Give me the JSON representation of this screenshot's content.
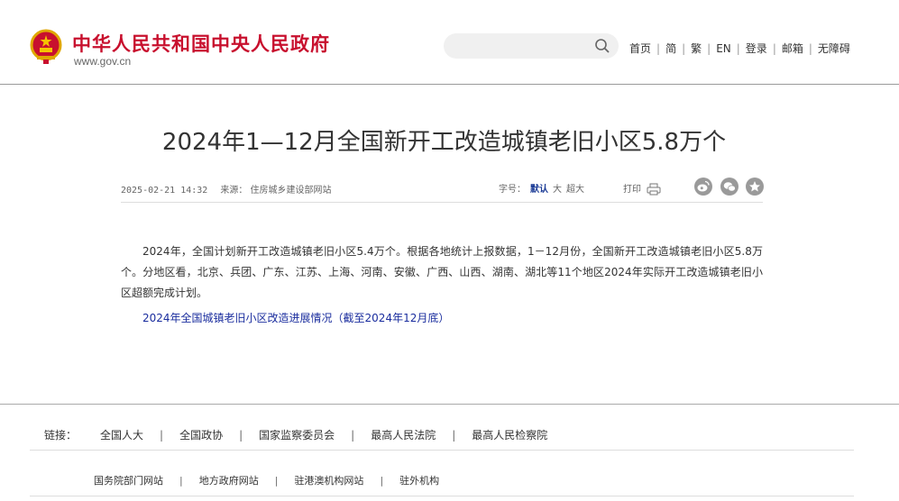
{
  "header": {
    "site_name": "中华人民共和国中央人民政府",
    "site_url": "www.gov.cn",
    "nav": [
      "首页",
      "简",
      "繁",
      "EN",
      "登录",
      "邮箱",
      "无障碍"
    ]
  },
  "icons": {
    "emblem": "national-emblem-icon",
    "search": "search-icon",
    "print": "printer-icon",
    "weibo": "weibo-icon",
    "wechat": "wechat-icon",
    "favorite": "star-icon"
  },
  "colors": {
    "brand_red": "#c8102e",
    "link_blue": "#1a2d9e",
    "active_blue": "#1c3c96"
  },
  "article": {
    "title": "2024年1—12月全国新开工改造城镇老旧小区5.8万个",
    "date": "2025-02-21 14:32",
    "source": "来源： 住房城乡建设部网站",
    "font_size_label": "字号：",
    "font_size_options": [
      "默认",
      "大",
      "超大"
    ],
    "font_size_selected": "默认",
    "print_label": "打印",
    "paragraph": "2024年，全国计划新开工改造城镇老旧小区5.4万个。根据各地统计上报数据，1－12月份，全国新开工改造城镇老旧小区5.8万个。分地区看，北京、兵团、广东、江苏、上海、河南、安徽、广西、山西、湖南、湖北等11个地区2024年实际开工改造城镇老旧小区超额完成计划。",
    "link_text": "2024年全国城镇老旧小区改造进展情况（截至2024年12月底）"
  },
  "footer": {
    "links_label": "链接：",
    "links": [
      "全国人大",
      "全国政协",
      "国家监察委员会",
      "最高人民法院",
      "最高人民检察院"
    ],
    "links2": [
      "国务院部门网站",
      "地方政府网站",
      "驻港澳机构网站",
      "驻外机构"
    ]
  }
}
